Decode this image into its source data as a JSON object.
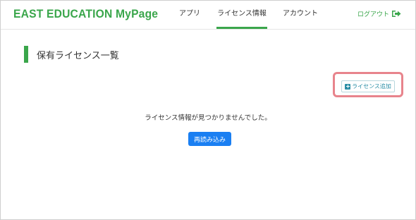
{
  "header": {
    "brand": "EAST EDUCATION  MyPage",
    "nav": [
      {
        "label": "アプリ"
      },
      {
        "label": "ライセンス情報"
      },
      {
        "label": "アカウント"
      }
    ],
    "logout_label": "ログアウト",
    "accent_color": "#3aa64b"
  },
  "main": {
    "title": "保有ライセンス一覧",
    "add_button_label": "ライセンス追加",
    "empty_message": "ライセンス情報が見つかりませんでした。",
    "reload_button_label": "再読み込み"
  },
  "icons": {
    "add": "plus-square-icon",
    "logout": "sign-out-icon"
  },
  "colors": {
    "primary_button": "#1a7ff2",
    "highlight": "#e8848c",
    "info_button": "#2c8fa6"
  }
}
